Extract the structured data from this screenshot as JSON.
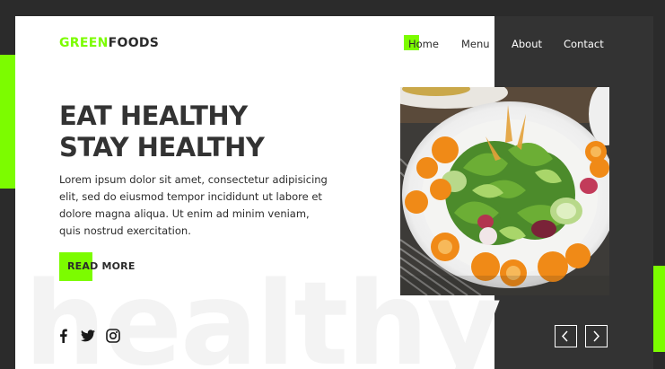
{
  "brand": {
    "part1": "GREEN",
    "part2": "FOODS"
  },
  "nav": {
    "items": [
      "Home",
      "Menu",
      "About",
      "Contact"
    ]
  },
  "hero": {
    "title_line1": "EAT HEALTHY",
    "title_line2": "STAY HEALTHY",
    "paragraph": "Lorem ipsum dolor sit amet, consectetur adipisicing elit, sed do eiusmod tempor incididunt ut labore et dolore magna aliqua. Ut enim ad minim veniam, quis nostrud exercitation.",
    "cta_label": "READ MORE",
    "watermark": "healthy"
  },
  "social": [
    "facebook-icon",
    "twitter-icon",
    "instagram-icon"
  ],
  "slider": {
    "prev_icon": "chevron-left-icon",
    "next_icon": "chevron-right-icon"
  },
  "colors": {
    "accent": "#7cfc00",
    "dark": "#333333",
    "background": "#2b2b2b",
    "text": "#2b2b2b"
  }
}
